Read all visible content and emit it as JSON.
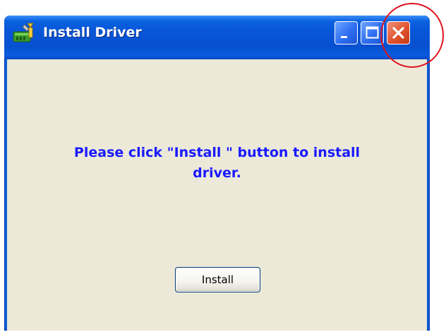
{
  "window": {
    "title": "Install Driver",
    "icon": "tools-driver-icon",
    "controls": {
      "minimize": "minimize-icon",
      "maximize": "maximize-icon",
      "close": "close-icon"
    }
  },
  "message": {
    "line1": "Please click \"Install \" button to install",
    "line2": "driver."
  },
  "install_button": {
    "label": "Install"
  },
  "colors": {
    "title_bar": "#0a5ed7",
    "client_background": "#ece9d8",
    "message_text": "#1a1aff",
    "close_button": "#e0532d",
    "annotation_circle": "#e0141e"
  }
}
